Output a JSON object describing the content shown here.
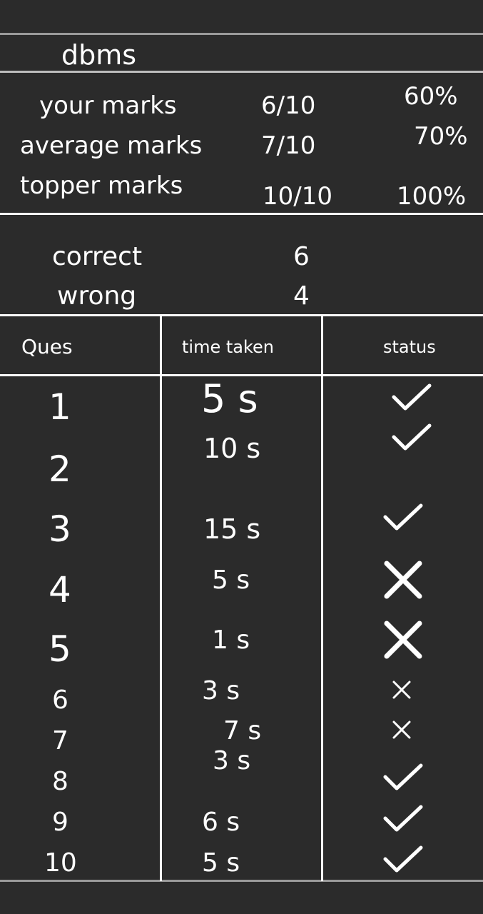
{
  "subject": "dbms",
  "marks": [
    {
      "label": "your marks",
      "score": "6/10",
      "percent": "60%"
    },
    {
      "label": "average marks",
      "score": "7/10",
      "percent": "70%"
    },
    {
      "label": "topper marks",
      "score": "10/10",
      "percent": "100%"
    }
  ],
  "summary": [
    {
      "label": "correct",
      "value": "6"
    },
    {
      "label": "wrong",
      "value": "4"
    }
  ],
  "table": {
    "headers": [
      "Ques",
      "time taken",
      "status"
    ],
    "rows": [
      {
        "q": "1",
        "time": "5 s",
        "status": "correct"
      },
      {
        "q": "2",
        "time": "10 s",
        "status": "correct"
      },
      {
        "q": "3",
        "time": "15 s",
        "status": "correct"
      },
      {
        "q": "4",
        "time": "5 s",
        "status": "wrong"
      },
      {
        "q": "5",
        "time": "1 s",
        "status": "wrong"
      },
      {
        "q": "6",
        "time": "3 s",
        "status": "wrong"
      },
      {
        "q": "7",
        "time": "7 s",
        "status": "wrong"
      },
      {
        "q": "8",
        "time": "3 s",
        "status": "correct"
      },
      {
        "q": "9",
        "time": "6 s",
        "status": "correct"
      },
      {
        "q": "10",
        "time": "5 s",
        "status": "correct"
      }
    ]
  },
  "colors": {
    "background": "#2b2b2b",
    "foreground": "#ffffff",
    "rule": "#bdbdbd"
  }
}
